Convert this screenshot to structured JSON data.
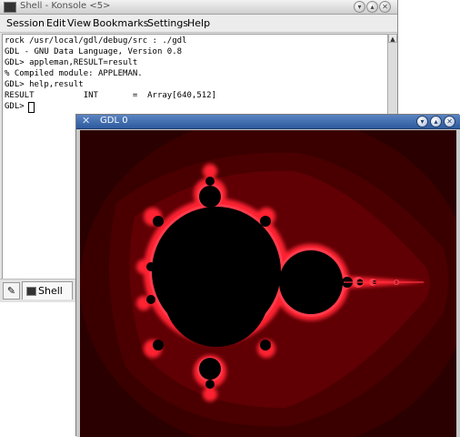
{
  "konsole": {
    "title": "Shell - Konsole <5>",
    "menu": [
      "Session",
      "Edit",
      "View",
      "Bookmarks",
      "Settings",
      "Help"
    ],
    "terminal_lines": [
      "rock /usr/local/gdl/debug/src : ./gdl",
      "GDL - GNU Data Language, Version 0.8",
      "GDL> appleman,RESULT=result",
      "% Compiled module: APPLEMAN.",
      "GDL> help,result",
      "RESULT          INT       =  Array[640,512]",
      "GDL> "
    ],
    "tab_label": "Shell"
  },
  "gdl_window": {
    "title": "GDL 0"
  },
  "colors": {
    "fractal_red": "#ff2030",
    "background_dark": "#2a0000",
    "titlebar_active": "#3d6bb0"
  }
}
